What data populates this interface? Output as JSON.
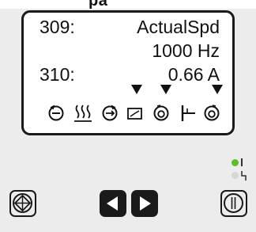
{
  "header": {
    "text": "pa"
  },
  "display": {
    "rows": [
      {
        "number": "309:",
        "name": "ActualSpd"
      },
      {
        "value": "1000 Hz"
      },
      {
        "number": "310:",
        "value": "0.66 A"
      }
    ]
  },
  "status_icons": [
    "reverse-rotation-icon",
    "heating-icon",
    "forward-rotation-icon",
    "ramp-icon",
    "rotation-icon",
    "brake-icon",
    "rotation-alt-icon"
  ],
  "colors": {
    "display_border": "#1a1a1a",
    "led_ready": "#5bbf2a",
    "led_fault": "#d6d6d6",
    "button": "#1a1a1a"
  }
}
